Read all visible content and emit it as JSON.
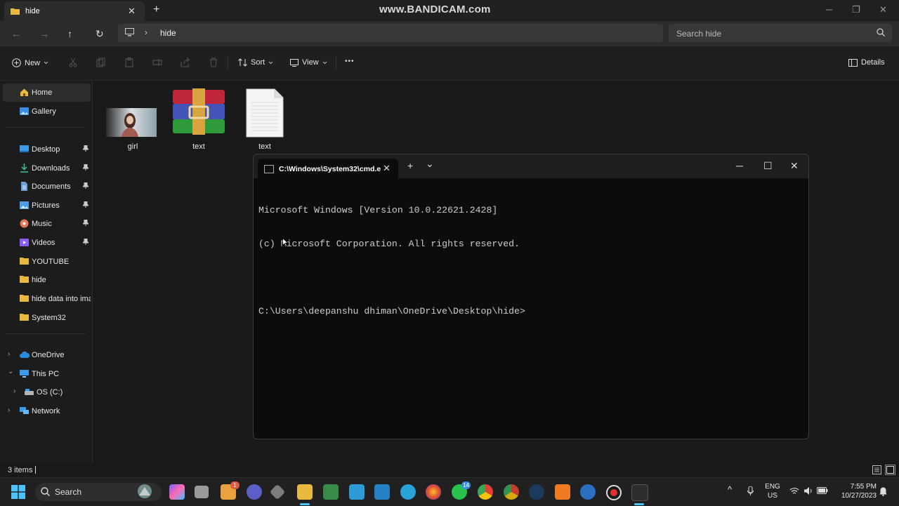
{
  "window": {
    "tab_title": "hide",
    "watermark": "www.BANDICAM.com",
    "minimize_glyph": "─",
    "restore_glyph": "❐",
    "close_glyph": "✕",
    "newtab_glyph": "+"
  },
  "nav": {
    "back_glyph": "←",
    "forward_glyph": "→",
    "up_glyph": "↑",
    "refresh_glyph": "↻",
    "breadcrumb_separator": "›",
    "breadcrumb": [
      "hide"
    ],
    "search_placeholder": "Search hide"
  },
  "toolbar": {
    "new_label": "New",
    "sort_label": "Sort",
    "view_label": "View",
    "more_glyph": "•••",
    "details_label": "Details",
    "disabled_icons": [
      "cut-icon",
      "copy-icon",
      "paste-icon",
      "rename-icon",
      "share-icon",
      "delete-icon"
    ]
  },
  "sidebar": {
    "home": "Home",
    "gallery": "Gallery",
    "quick_access": [
      {
        "label": "Desktop",
        "icon": "desktop-icon",
        "pinned": true
      },
      {
        "label": "Downloads",
        "icon": "downloads-icon",
        "pinned": true
      },
      {
        "label": "Documents",
        "icon": "documents-icon",
        "pinned": true
      },
      {
        "label": "Pictures",
        "icon": "pictures-icon",
        "pinned": true
      },
      {
        "label": "Music",
        "icon": "music-icon",
        "pinned": true
      },
      {
        "label": "Videos",
        "icon": "videos-icon",
        "pinned": true
      },
      {
        "label": "YOUTUBE",
        "icon": "folder-icon",
        "pinned": false
      },
      {
        "label": "hide",
        "icon": "folder-icon",
        "pinned": false
      },
      {
        "label": "hide data into imag",
        "icon": "folder-icon",
        "pinned": false
      },
      {
        "label": "System32",
        "icon": "folder-icon",
        "pinned": false
      }
    ],
    "pin_glyph": "📌",
    "onedrive": "OneDrive",
    "this_pc": "This PC",
    "os_drive": "OS (C:)",
    "network": "Network",
    "expand_glyph": "›",
    "expanded_glyph": "⌄"
  },
  "files": [
    {
      "name": "girl",
      "type": "image"
    },
    {
      "name": "text",
      "type": "rar-archive"
    },
    {
      "name": "text",
      "type": "text-document"
    }
  ],
  "status": {
    "item_count": "3 items"
  },
  "cmd": {
    "tab_title": "C:\\Windows\\System32\\cmd.e",
    "close_tab_glyph": "✕",
    "new_tab_glyph": "+",
    "dropdown_glyph": "⌄",
    "minimize_glyph": "─",
    "maximize_glyph": "☐",
    "close_glyph": "✕",
    "lines": [
      "Microsoft Windows [Version 10.0.22621.2428]",
      "(c) Microsoft Corporation. All rights reserved.",
      "",
      "C:\\Users\\deepanshu dhiman\\OneDrive\\Desktop\\hide>"
    ]
  },
  "taskbar": {
    "search_label": "Search",
    "apps": [
      "start",
      "copilot",
      "task-view",
      "file-history",
      "mail",
      "meet",
      "hex-app",
      "file-explorer",
      "sourcetree",
      "office",
      "vscode",
      "telegram",
      "firefox",
      "whatsapp",
      "chrome",
      "chrome-canary",
      "steam",
      "xampp",
      "app-blue",
      "bandicam-record",
      "terminal"
    ],
    "badges": {
      "file-history": "1",
      "whatsapp": "14"
    },
    "tray": {
      "chevron": "^",
      "lang": "ENG",
      "region": "US",
      "time": "7:55 PM",
      "date": "10/27/2023"
    }
  },
  "colors": {
    "accent": "#4cc2ff",
    "folder": "#e8b93e",
    "console_bg": "#0c0c0c",
    "console_fg": "#cccccc"
  }
}
